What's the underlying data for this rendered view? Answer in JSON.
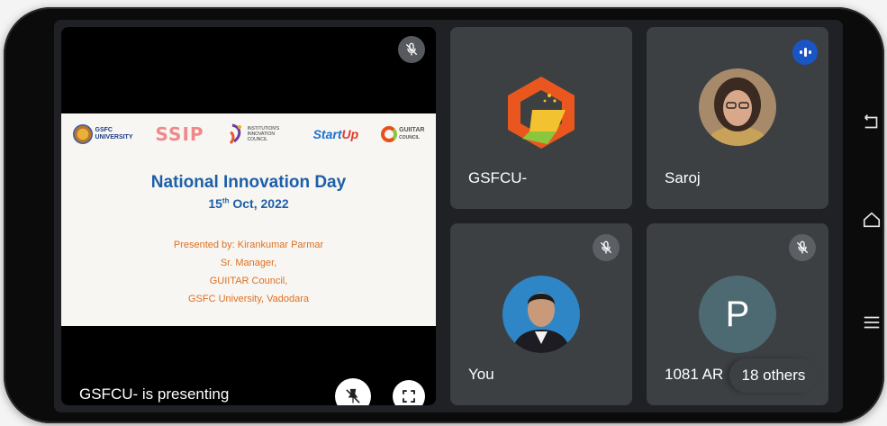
{
  "slide": {
    "title": "National Innovation Day",
    "date_day": "15",
    "date_sup": "th",
    "date_rest": " Oct, 2022",
    "lines": [
      "Presented by: Kirankumar Parmar",
      "Sr. Manager,",
      "GUIITAR Council,",
      "GSFC University, Vadodara"
    ],
    "logos": {
      "gsfc_line1": "GSFC",
      "gsfc_line2": "UNIVERSITY",
      "ssip": "SSIP",
      "iic_text": "INSTITUTION'S INNOVATION COUNCIL",
      "startup_a": "Start",
      "startup_b": "Up",
      "guiitar_line1": "GUIITAR",
      "guiitar_line2": "COUNCIL"
    }
  },
  "presenting_label": "GSFCU- is presenting",
  "participants": [
    {
      "name": "GSFCU-",
      "muted": false,
      "speaking": false
    },
    {
      "name": "Saroj",
      "muted": false,
      "speaking": true
    },
    {
      "name": "You",
      "muted": true,
      "speaking": false
    },
    {
      "name": "1081 AR",
      "initial": "P",
      "muted": true,
      "speaking": false
    }
  ],
  "others_label": "18 others",
  "icons": {
    "mic_off": "mic-off-icon",
    "pin_off": "unpin-icon",
    "fullscreen": "fullscreen-icon",
    "speaking": "audio-wave-icon",
    "nav": [
      "back-icon",
      "home-icon",
      "menu-icon"
    ]
  },
  "colors": {
    "tile_bg": "#3c4043",
    "screen_bg": "#202124",
    "speaking_blue": "#1a55c6",
    "slide_title": "#1e5fa8",
    "slide_orange": "#e07020"
  }
}
